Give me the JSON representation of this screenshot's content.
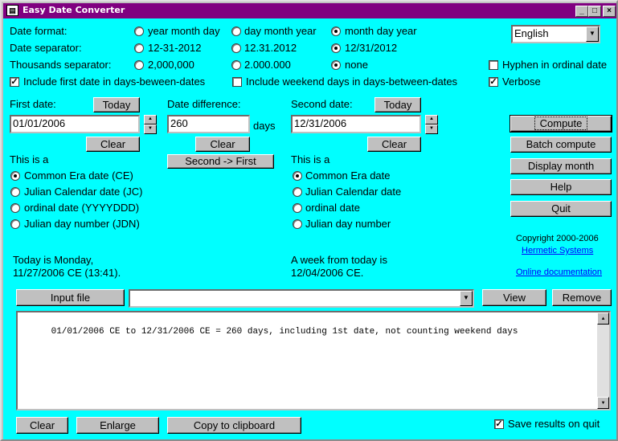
{
  "window": {
    "title": "Easy Date Converter"
  },
  "format": {
    "date_format_label": "Date format:",
    "date_format_options": [
      "year month day",
      "day month year",
      "month day year"
    ],
    "date_separator_label": "Date separator:",
    "date_separator_options": [
      "12-31-2012",
      "12.31.2012",
      "12/31/2012"
    ],
    "thousands_label": "Thousands separator:",
    "thousands_options": [
      "2,000,000",
      "2.000.000",
      "none"
    ],
    "language": "English",
    "hyphen_label": "Hyphen in ordinal date",
    "verbose_label": "Verbose",
    "include_first_label": "Include first date in days-beween-dates",
    "include_weekend_label": "Include weekend days in days-between-dates"
  },
  "first": {
    "label": "First date:",
    "today_btn": "Today",
    "value": "01/01/2006",
    "clear_btn": "Clear",
    "this_is": "This is a",
    "options": [
      "Common Era date (CE)",
      "Julian Calendar date (JC)",
      "ordinal date (YYYYDDD)",
      "Julian day number (JDN)"
    ]
  },
  "diff": {
    "label": "Date difference:",
    "value": "260",
    "unit": "days",
    "clear_btn": "Clear",
    "second_first_btn": "Second -> First"
  },
  "second": {
    "label": "Second date:",
    "today_btn": "Today",
    "value": "12/31/2006",
    "clear_btn": "Clear",
    "this_is": "This is a",
    "options": [
      "Common Era date",
      "Julian Calendar date",
      "ordinal date",
      "Julian day number"
    ]
  },
  "actions": {
    "compute": "Compute",
    "batch": "Batch compute",
    "display_month": "Display month",
    "help": "Help",
    "quit": "Quit"
  },
  "info": {
    "copyright": "Copyright 2000-2006",
    "company": "Hermetic Systems",
    "docs": "Online documentation",
    "today_line1": "Today is Monday,",
    "today_line2": "11/27/2006 CE (13:41).",
    "week_line1": "A week from today is",
    "week_line2": "12/04/2006 CE."
  },
  "file": {
    "input_btn": "Input file",
    "value": "",
    "view_btn": "View",
    "remove_btn": "Remove"
  },
  "output": {
    "text": "01/01/2006 CE to 12/31/2006 CE = 260 days, including 1st date, not counting weekend days"
  },
  "bottom": {
    "clear": "Clear",
    "enlarge": "Enlarge",
    "copy": "Copy to clipboard",
    "save_label": "Save results on quit"
  }
}
